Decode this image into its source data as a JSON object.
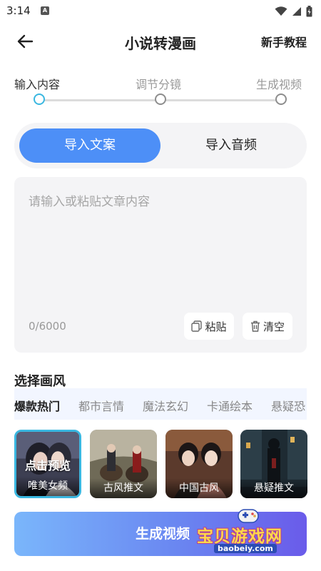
{
  "status_bar": {
    "time": "3:14",
    "app_icon_letter": "A"
  },
  "header": {
    "title": "小说转漫画",
    "tutorial": "新手教程"
  },
  "stepper": {
    "steps": [
      "输入内容",
      "调节分镜",
      "生成视频"
    ],
    "active_index": 0,
    "active_color": "#3ab7e0"
  },
  "import_tabs": {
    "items": [
      "导入文案",
      "导入音频"
    ],
    "active_index": 0,
    "active_color": "#4d8ff7"
  },
  "text_input": {
    "placeholder": "请输入或粘贴文章内容",
    "char_count": "0/6000",
    "paste_label": "粘贴",
    "clear_label": "清空"
  },
  "style_section": {
    "title": "选择画风",
    "categories": [
      "爆款热门",
      "都市言情",
      "魔法玄幻",
      "卡通绘本",
      "悬疑恐"
    ],
    "active_category": 0,
    "cards": [
      {
        "label": "唯美女频",
        "selected": true,
        "overlay": "点击预览"
      },
      {
        "label": "古风推文",
        "selected": false
      },
      {
        "label": "中国古风",
        "selected": false
      },
      {
        "label": "悬疑推文",
        "selected": false
      }
    ]
  },
  "generate_button": {
    "label": "生成视频"
  },
  "watermark": {
    "text": "宝贝游戏网",
    "url": "baobeiy.com"
  }
}
